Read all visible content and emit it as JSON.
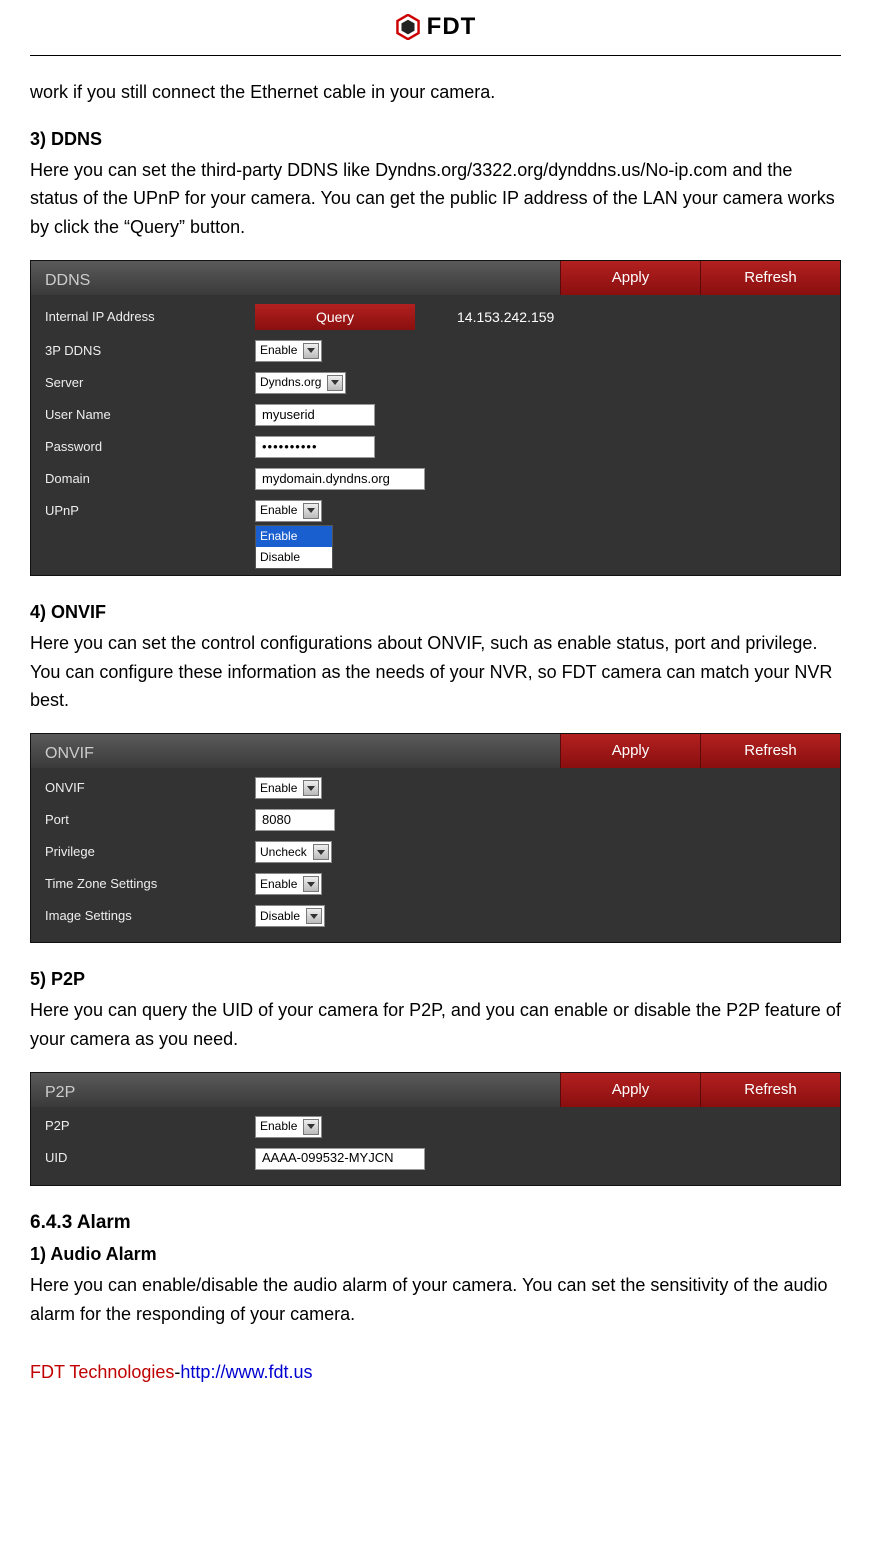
{
  "header": {
    "brand": "FDT"
  },
  "intro_continued": "work if you still connect the Ethernet cable in your camera.",
  "sec_ddns": {
    "h": "3) DDNS",
    "p": "Here you can set the third-party DDNS like Dyndns.org/3322.org/dynddns.us/No-ip.com and the status of the UPnP for your camera. You can get the public IP address of the LAN your camera works by click the “Query” button."
  },
  "panel_ddns": {
    "title": "DDNS",
    "apply": "Apply",
    "refresh": "Refresh",
    "rows": {
      "internal_ip_label": "Internal IP Address",
      "query": "Query",
      "ip_value": "14.153.242.159",
      "p3_label": "3P DDNS",
      "p3_value": "Enable",
      "server_label": "Server",
      "server_value": "Dyndns.org",
      "user_label": "User Name",
      "user_value": "myuserid",
      "pass_label": "Password",
      "pass_value": "••••••••••",
      "domain_label": "Domain",
      "domain_value": "mydomain.dyndns.org",
      "upnp_label": "UPnP",
      "upnp_value": "Enable",
      "dd_enable": "Enable",
      "dd_disable": "Disable"
    }
  },
  "sec_onvif": {
    "h": "4) ONVIF",
    "p": "Here you can set the control configurations about ONVIF, such as enable status, port and privilege. You can configure these information as the needs of your NVR, so FDT camera can match your NVR best."
  },
  "panel_onvif": {
    "title": "ONVIF",
    "apply": "Apply",
    "refresh": "Refresh",
    "rows": {
      "onvif_label": "ONVIF",
      "onvif_value": "Enable",
      "port_label": "Port",
      "port_value": "8080",
      "priv_label": "Privilege",
      "priv_value": "Uncheck",
      "tz_label": "Time Zone Settings",
      "tz_value": "Enable",
      "img_label": "Image Settings",
      "img_value": "Disable"
    }
  },
  "sec_p2p": {
    "h": "5) P2P",
    "p": "Here you can query the UID of your camera for P2P, and you can enable or disable the P2P feature of your camera as you need."
  },
  "panel_p2p": {
    "title": "P2P",
    "apply": "Apply",
    "refresh": "Refresh",
    "rows": {
      "p2p_label": "P2P",
      "p2p_value": "Enable",
      "uid_label": "UID",
      "uid_value": "AAAA-099532-MYJCN"
    }
  },
  "sec_alarm": {
    "h": "6.4.3 Alarm",
    "sub": "1) Audio Alarm",
    "p": "Here you can enable/disable the audio alarm of your camera. You can set the sensitivity of the audio alarm for the responding of your camera."
  },
  "footer": {
    "company": "FDT Technologies",
    "dash": "-",
    "link": "http://www.fdt.us"
  }
}
